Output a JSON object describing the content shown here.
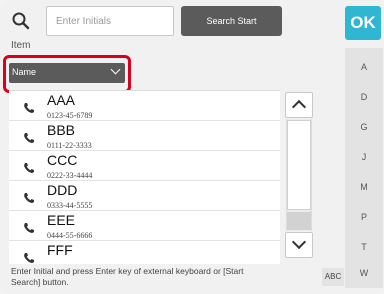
{
  "header": {
    "item_label": "Item",
    "initials_placeholder": "Enter Initials",
    "initials_value": "",
    "search_start_label": "Search Start",
    "ok_label": "OK"
  },
  "filter": {
    "selected": "Name"
  },
  "contacts": [
    {
      "name": "AAA",
      "number": "0123-45-6789"
    },
    {
      "name": "BBB",
      "number": "0111-22-3333"
    },
    {
      "name": "CCC",
      "number": "0222-33-4444"
    },
    {
      "name": "DDD",
      "number": "0333-44-5555"
    },
    {
      "name": "EEE",
      "number": "0444-55-6666"
    },
    {
      "name": "FFF",
      "number": ""
    }
  ],
  "index_letters": [
    "A",
    "D",
    "G",
    "J",
    "M",
    "P",
    "T",
    "W"
  ],
  "footer": {
    "hint": "Enter Initial and press Enter key of external keyboard or [Start Search] button.",
    "abc_label": "ABC"
  },
  "colors": {
    "accent": "#2fb6d3",
    "highlight": "#d8001e",
    "button_dark": "#5b5b5b"
  }
}
